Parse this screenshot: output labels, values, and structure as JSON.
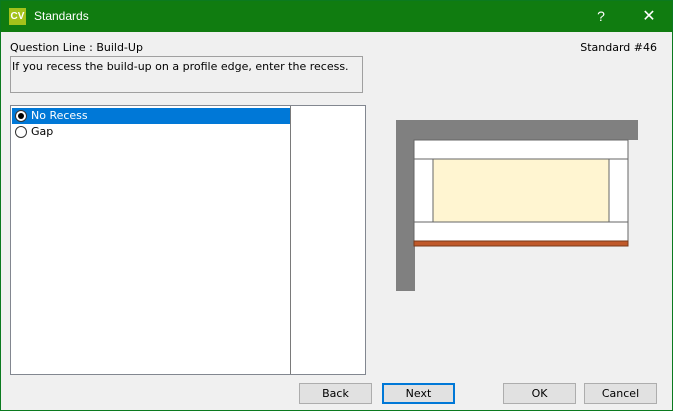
{
  "window": {
    "app_icon_text": "CV",
    "title": "Standards",
    "help_label": "?",
    "close_label": "✕",
    "titlebar_color": "#107c10"
  },
  "header": {
    "question_label": "Question Line : Build-Up",
    "standard_label": "Standard #46"
  },
  "description": "If you recess the build-up on a profile edge, enter the recess.",
  "options": [
    {
      "label": "No Recess",
      "selected": true
    },
    {
      "label": "Gap",
      "selected": false
    }
  ],
  "buttons": {
    "back": "Back",
    "next": "Next",
    "ok": "OK",
    "cancel": "Cancel"
  },
  "colors": {
    "selection": "#0078d7",
    "wall": "#808080",
    "core": "#fff5d1",
    "edge_strip": "#c0592a"
  }
}
